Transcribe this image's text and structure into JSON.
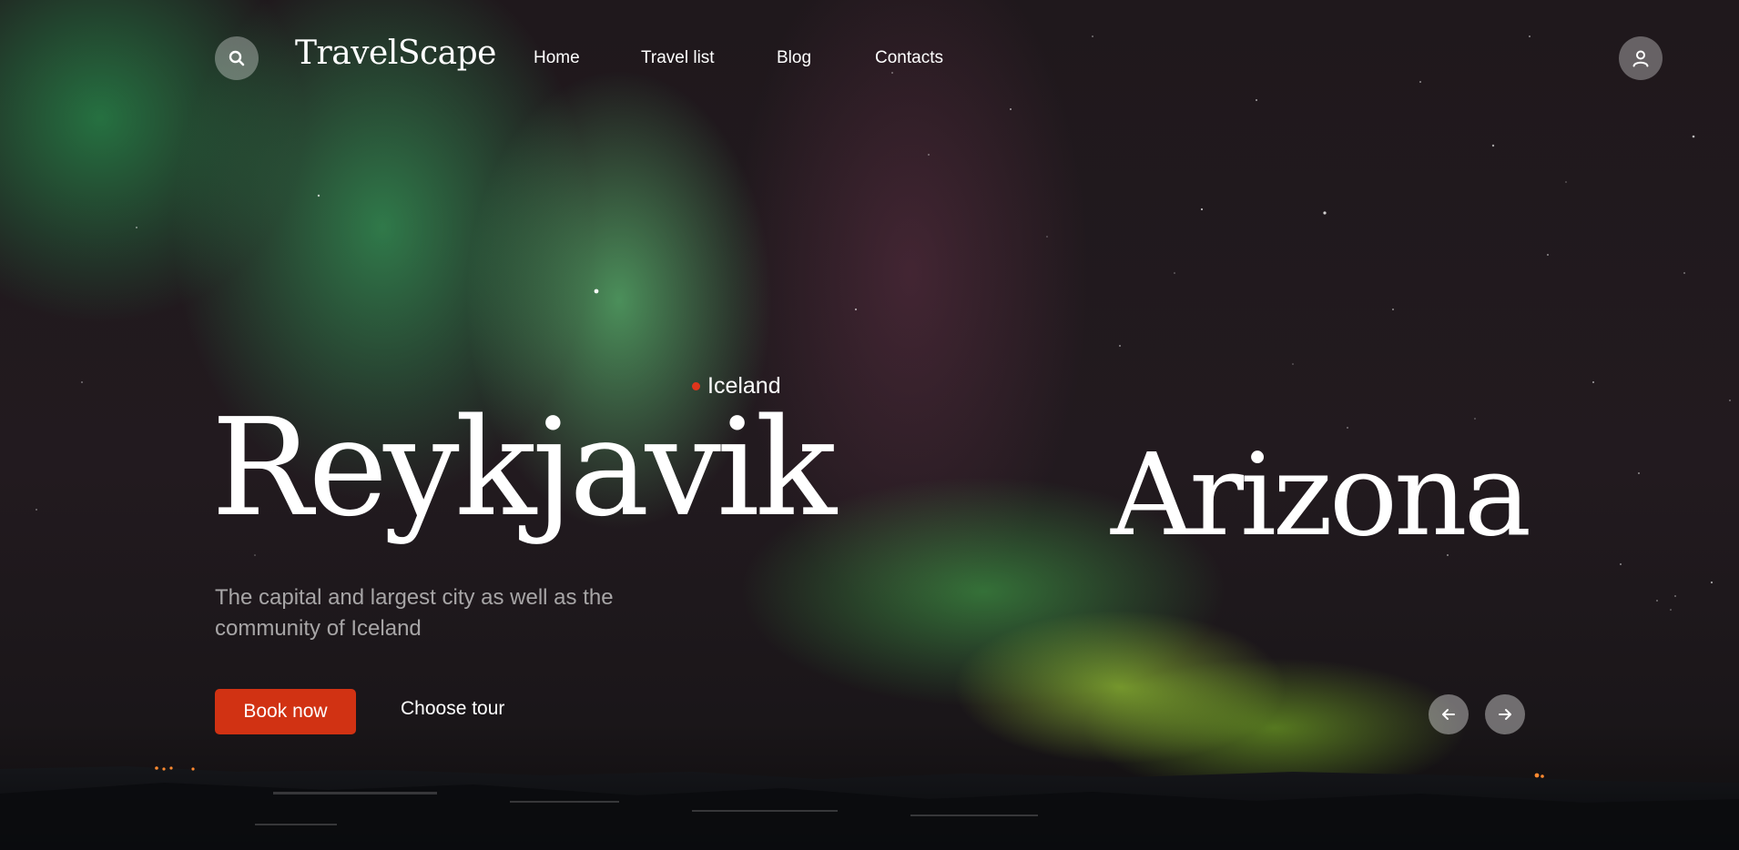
{
  "header": {
    "logo": "TravelScape",
    "nav": [
      {
        "label": "Home"
      },
      {
        "label": "Travel list"
      },
      {
        "label": "Blog"
      },
      {
        "label": "Contacts"
      }
    ],
    "search_icon": "search-icon",
    "account_icon": "user-icon"
  },
  "hero": {
    "country": "Iceland",
    "city": "Reykjavik",
    "description": "The capital and largest city as well as the community of Iceland",
    "book_label": "Book now",
    "tour_label": "Choose tour",
    "next_city": "Arizona",
    "prev_icon": "arrow-left-icon",
    "next_icon": "arrow-right-icon"
  },
  "colors": {
    "accent": "#d13213",
    "marker": "#e0351b",
    "text": "#ffffff",
    "muted_text": "#c8c8c8",
    "aurora_green": "#5fe07a"
  }
}
